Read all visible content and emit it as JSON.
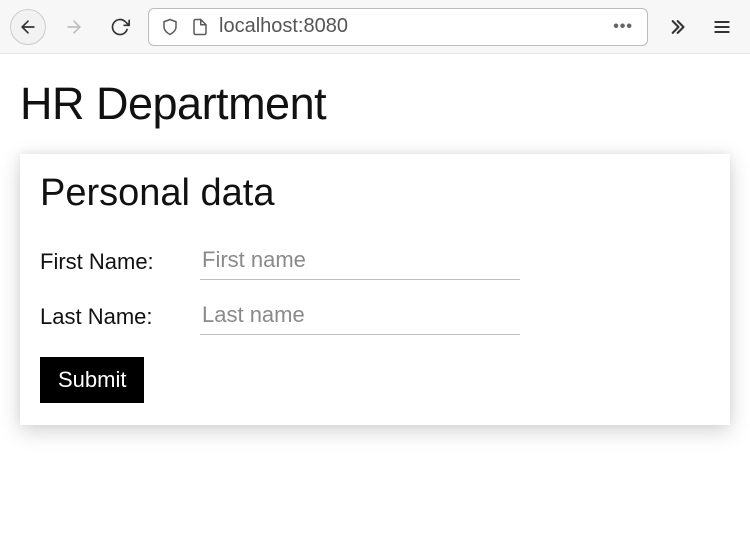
{
  "browser": {
    "url": "localhost:8080"
  },
  "page": {
    "title": "HR Department"
  },
  "form": {
    "section_heading": "Personal data",
    "first_name": {
      "label": "First Name:",
      "placeholder": "First name",
      "value": ""
    },
    "last_name": {
      "label": "Last Name:",
      "placeholder": "Last name",
      "value": ""
    },
    "submit_label": "Submit"
  }
}
